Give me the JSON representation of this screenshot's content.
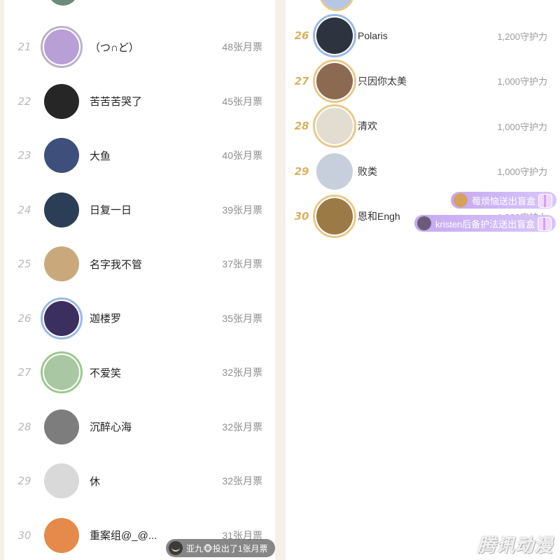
{
  "monthly_ticket_list": [
    {
      "rank": "21",
      "name": "（つ∩ど）",
      "value": "48张月票",
      "avatar_color": "#b89fd6",
      "frame": "silver"
    },
    {
      "rank": "22",
      "name": "苦苦苦哭了",
      "value": "45张月票",
      "avatar_color": "#262626",
      "frame": "none"
    },
    {
      "rank": "23",
      "name": "大鱼",
      "value": "40张月票",
      "avatar_color": "#3d4f7a",
      "frame": "none"
    },
    {
      "rank": "24",
      "name": "日复一日",
      "value": "39张月票",
      "avatar_color": "#2c3e55",
      "frame": "none"
    },
    {
      "rank": "25",
      "name": "名字我不管",
      "value": "37张月票",
      "avatar_color": "#c9a97c",
      "frame": "none"
    },
    {
      "rank": "26",
      "name": "迦楼罗",
      "value": "35张月票",
      "avatar_color": "#3a2f5e",
      "frame": "blue"
    },
    {
      "rank": "27",
      "name": "不爱笑",
      "value": "32张月票",
      "avatar_color": "#a9c7a2",
      "frame": "green"
    },
    {
      "rank": "28",
      "name": "沉醉心海",
      "value": "32张月票",
      "avatar_color": "#7d7d7d",
      "frame": "none"
    },
    {
      "rank": "29",
      "name": "休",
      "value": "32张月票",
      "avatar_color": "#d9d9d9",
      "frame": "none"
    },
    {
      "rank": "30",
      "name": "重案组@_@...",
      "value": "31张月票",
      "avatar_color": "#e58a4a",
      "frame": "none"
    }
  ],
  "guardian_list": [
    {
      "rank": "26",
      "name": "Polaris",
      "value": "1,200守护力",
      "avatar_color": "#2e3340",
      "frame": "blue"
    },
    {
      "rank": "27",
      "name": "只因你太美",
      "value": "1,000守护力",
      "avatar_color": "#8c6a52",
      "frame": "gold"
    },
    {
      "rank": "28",
      "name": "清欢",
      "value": "1,000守护力",
      "avatar_color": "#e3dcd0",
      "frame": "gold"
    },
    {
      "rank": "29",
      "name": "败类",
      "value": "1,000守护力",
      "avatar_color": "#c7cfdc",
      "frame": "none"
    },
    {
      "rank": "30",
      "name": "恩和Engh",
      "value": "1,000守护力",
      "avatar_color": "#9b7a45",
      "frame": "gold"
    }
  ],
  "gift_toasts": [
    {
      "text": "莓烦恼送出盲盒",
      "avatar_color": "#d6a15a"
    },
    {
      "text": "kristen后备护法送出盲盒",
      "avatar_color": "#6b5a7a"
    }
  ],
  "vote_toast": {
    "text": "亚九🐵投出了1张月票"
  },
  "watermark": "腾讯动漫",
  "colors": {
    "accent_gold": "#d8b25d",
    "toast_purple": "#c6a9f0",
    "page_bg": "#f6f1e7"
  }
}
